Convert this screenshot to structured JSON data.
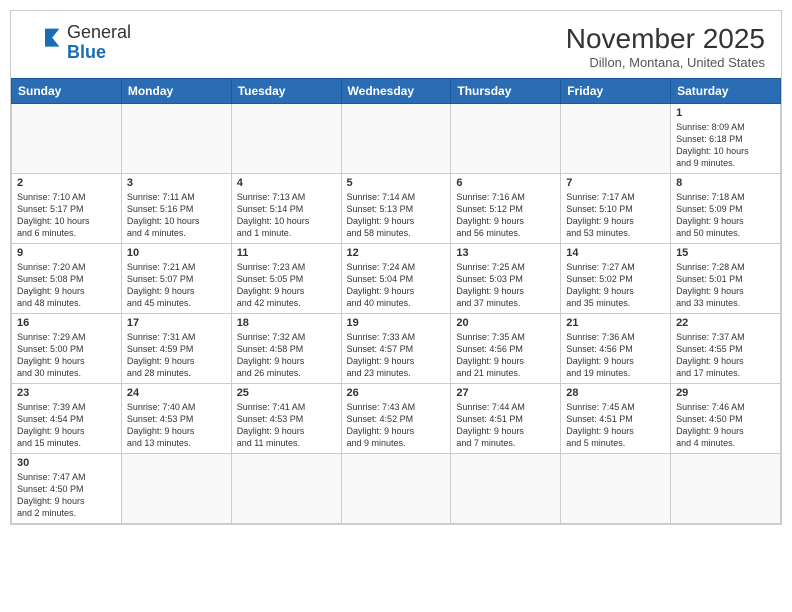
{
  "header": {
    "logo_general": "General",
    "logo_blue": "Blue",
    "month_title": "November 2025",
    "location": "Dillon, Montana, United States"
  },
  "weekdays": [
    "Sunday",
    "Monday",
    "Tuesday",
    "Wednesday",
    "Thursday",
    "Friday",
    "Saturday"
  ],
  "weeks": [
    [
      {
        "day": "",
        "info": ""
      },
      {
        "day": "",
        "info": ""
      },
      {
        "day": "",
        "info": ""
      },
      {
        "day": "",
        "info": ""
      },
      {
        "day": "",
        "info": ""
      },
      {
        "day": "",
        "info": ""
      },
      {
        "day": "1",
        "info": "Sunrise: 8:09 AM\nSunset: 6:18 PM\nDaylight: 10 hours\nand 9 minutes."
      }
    ],
    [
      {
        "day": "2",
        "info": "Sunrise: 7:10 AM\nSunset: 5:17 PM\nDaylight: 10 hours\nand 6 minutes."
      },
      {
        "day": "3",
        "info": "Sunrise: 7:11 AM\nSunset: 5:16 PM\nDaylight: 10 hours\nand 4 minutes."
      },
      {
        "day": "4",
        "info": "Sunrise: 7:13 AM\nSunset: 5:14 PM\nDaylight: 10 hours\nand 1 minute."
      },
      {
        "day": "5",
        "info": "Sunrise: 7:14 AM\nSunset: 5:13 PM\nDaylight: 9 hours\nand 58 minutes."
      },
      {
        "day": "6",
        "info": "Sunrise: 7:16 AM\nSunset: 5:12 PM\nDaylight: 9 hours\nand 56 minutes."
      },
      {
        "day": "7",
        "info": "Sunrise: 7:17 AM\nSunset: 5:10 PM\nDaylight: 9 hours\nand 53 minutes."
      },
      {
        "day": "8",
        "info": "Sunrise: 7:18 AM\nSunset: 5:09 PM\nDaylight: 9 hours\nand 50 minutes."
      }
    ],
    [
      {
        "day": "9",
        "info": "Sunrise: 7:20 AM\nSunset: 5:08 PM\nDaylight: 9 hours\nand 48 minutes."
      },
      {
        "day": "10",
        "info": "Sunrise: 7:21 AM\nSunset: 5:07 PM\nDaylight: 9 hours\nand 45 minutes."
      },
      {
        "day": "11",
        "info": "Sunrise: 7:23 AM\nSunset: 5:05 PM\nDaylight: 9 hours\nand 42 minutes."
      },
      {
        "day": "12",
        "info": "Sunrise: 7:24 AM\nSunset: 5:04 PM\nDaylight: 9 hours\nand 40 minutes."
      },
      {
        "day": "13",
        "info": "Sunrise: 7:25 AM\nSunset: 5:03 PM\nDaylight: 9 hours\nand 37 minutes."
      },
      {
        "day": "14",
        "info": "Sunrise: 7:27 AM\nSunset: 5:02 PM\nDaylight: 9 hours\nand 35 minutes."
      },
      {
        "day": "15",
        "info": "Sunrise: 7:28 AM\nSunset: 5:01 PM\nDaylight: 9 hours\nand 33 minutes."
      }
    ],
    [
      {
        "day": "16",
        "info": "Sunrise: 7:29 AM\nSunset: 5:00 PM\nDaylight: 9 hours\nand 30 minutes."
      },
      {
        "day": "17",
        "info": "Sunrise: 7:31 AM\nSunset: 4:59 PM\nDaylight: 9 hours\nand 28 minutes."
      },
      {
        "day": "18",
        "info": "Sunrise: 7:32 AM\nSunset: 4:58 PM\nDaylight: 9 hours\nand 26 minutes."
      },
      {
        "day": "19",
        "info": "Sunrise: 7:33 AM\nSunset: 4:57 PM\nDaylight: 9 hours\nand 23 minutes."
      },
      {
        "day": "20",
        "info": "Sunrise: 7:35 AM\nSunset: 4:56 PM\nDaylight: 9 hours\nand 21 minutes."
      },
      {
        "day": "21",
        "info": "Sunrise: 7:36 AM\nSunset: 4:56 PM\nDaylight: 9 hours\nand 19 minutes."
      },
      {
        "day": "22",
        "info": "Sunrise: 7:37 AM\nSunset: 4:55 PM\nDaylight: 9 hours\nand 17 minutes."
      }
    ],
    [
      {
        "day": "23",
        "info": "Sunrise: 7:39 AM\nSunset: 4:54 PM\nDaylight: 9 hours\nand 15 minutes."
      },
      {
        "day": "24",
        "info": "Sunrise: 7:40 AM\nSunset: 4:53 PM\nDaylight: 9 hours\nand 13 minutes."
      },
      {
        "day": "25",
        "info": "Sunrise: 7:41 AM\nSunset: 4:53 PM\nDaylight: 9 hours\nand 11 minutes."
      },
      {
        "day": "26",
        "info": "Sunrise: 7:43 AM\nSunset: 4:52 PM\nDaylight: 9 hours\nand 9 minutes."
      },
      {
        "day": "27",
        "info": "Sunrise: 7:44 AM\nSunset: 4:51 PM\nDaylight: 9 hours\nand 7 minutes."
      },
      {
        "day": "28",
        "info": "Sunrise: 7:45 AM\nSunset: 4:51 PM\nDaylight: 9 hours\nand 5 minutes."
      },
      {
        "day": "29",
        "info": "Sunrise: 7:46 AM\nSunset: 4:50 PM\nDaylight: 9 hours\nand 4 minutes."
      }
    ],
    [
      {
        "day": "30",
        "info": "Sunrise: 7:47 AM\nSunset: 4:50 PM\nDaylight: 9 hours\nand 2 minutes."
      },
      {
        "day": "",
        "info": ""
      },
      {
        "day": "",
        "info": ""
      },
      {
        "day": "",
        "info": ""
      },
      {
        "day": "",
        "info": ""
      },
      {
        "day": "",
        "info": ""
      },
      {
        "day": "",
        "info": ""
      }
    ]
  ]
}
